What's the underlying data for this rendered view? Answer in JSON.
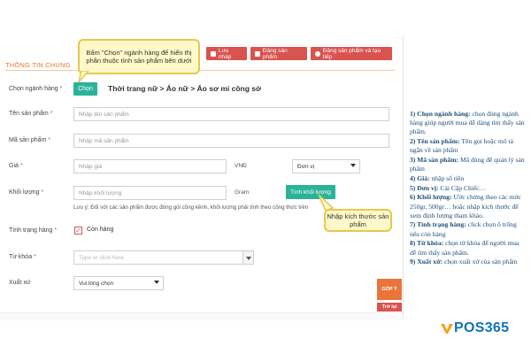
{
  "section_title": "THÔNG TIN CHUNG",
  "toolbar": {
    "save_draft": "Lưu nháp",
    "post_product": "Đăng sản phẩm",
    "post_and_create": "Đăng sản phẩm và tạo tiếp"
  },
  "callouts": {
    "top": "Bấm \"Chọn\" ngành hàng để hiển thị phần thuộc tính sản phẩm bên dưới",
    "size": "Nhập kích thước sản phẩm"
  },
  "form": {
    "category_label": "Chọn ngành hàng",
    "choose_button": "Chọn",
    "category_path": "Thời trang nữ > Áo nữ > Áo sơ mi công sở",
    "name_label": "Tên sản phẩm",
    "name_placeholder": "Nhập tên sản phẩm",
    "sku_label": "Mã sản phẩm",
    "sku_placeholder": "Nhập mã sản phẩm",
    "price_label": "Giá",
    "price_placeholder": "Nhập giá",
    "currency": "VNĐ",
    "unit_value": "Đơn vị",
    "weight_label": "Khối lượng",
    "weight_placeholder": "Nhập khối lượng",
    "weight_unit": "Gram",
    "calc_weight_button": "Tính khối lượng",
    "weight_note": "Lưu ý: Đối với các sản phẩm được đóng gói cồng kềnh, khối lượng phải tính theo công thức trên",
    "stock_label": "Tình trạng hàng",
    "stock_value": "Còn hàng",
    "keyword_label": "Từ khóa",
    "keyword_placeholder": "Type or click here",
    "origin_label": "Xuất xứ",
    "origin_value": "Vui lòng chọn",
    "required_mark": "*"
  },
  "side_tabs": {
    "feedback": "GÓP Ý",
    "back": "Trở lại"
  },
  "help": [
    {
      "num": "1) Chọn ngành hàng:",
      "text": " chọn đúng ngành hàng giúp người mua dễ dàng tìm thấy sản phẩm."
    },
    {
      "num": "2) Tên sản phẩm:",
      "text": " Tên gọi hoặc mô tả ngắn về sản phẩm"
    },
    {
      "num": "3) Mã sản phẩm:",
      "text": " Mã dùng để quản lý sản phẩm"
    },
    {
      "num": "4) Giá:",
      "text": " nhập số tiền"
    },
    {
      "num": "5) Đơn vị:",
      "text": " Cái Cặp Chiếc…"
    },
    {
      "num": "6) Khối lượng:",
      "text": " Ước chừng theo các mức 250gr, 500gr… hoặc nhập kích thước để xem định lượng tham khảo."
    },
    {
      "num": "7) Tình trạng hàng:",
      "text": " click chọn ô trống nếu còn hàng"
    },
    {
      "num": "8) Từ khóa:",
      "text": " chọn từ khóa để người mua dễ tìm thấy sản phẩm."
    },
    {
      "num": "9) Xuất xứ:",
      "text": " chọn xuất xứ của sản phẩm"
    }
  ],
  "logo": "POS365",
  "colors": {
    "accent_red": "#d9534f",
    "accent_teal": "#2bb39a",
    "callout_bg": "#fff8c8",
    "help_text": "#1f4e79",
    "logo_blue": "#0f73b8"
  }
}
